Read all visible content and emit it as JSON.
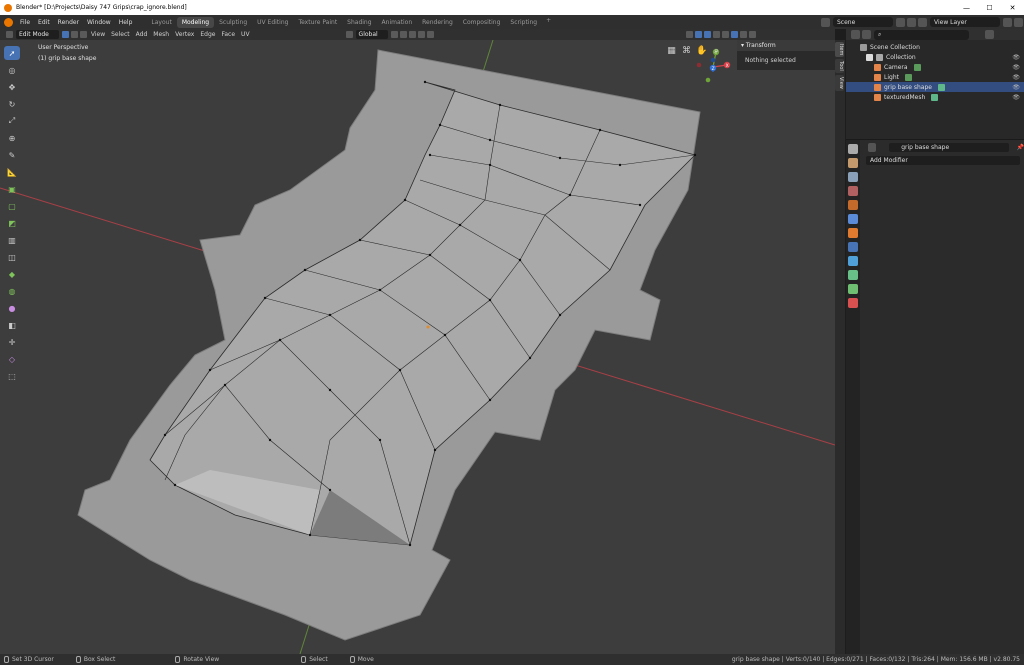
{
  "window": {
    "title": "Blender* [D:\\Projects\\Daisy 747 Grips\\crap_ignore.blend]",
    "min": "—",
    "max": "☐",
    "close": "✕"
  },
  "menu": {
    "items": [
      "File",
      "Edit",
      "Render",
      "Window",
      "Help"
    ],
    "workspaces": [
      "Layout",
      "Modeling",
      "Sculpting",
      "UV Editing",
      "Texture Paint",
      "Shading",
      "Animation",
      "Rendering",
      "Compositing",
      "Scripting"
    ],
    "active_workspace": "Modeling",
    "add": "+",
    "scene": "Scene",
    "view_layer": "View Layer"
  },
  "viewport_header": {
    "mode": "Edit Mode",
    "menus": [
      "View",
      "Select",
      "Add",
      "Mesh",
      "Vertex",
      "Edge",
      "Face",
      "UV"
    ],
    "orientation": "Global"
  },
  "viewport": {
    "view_name": "User Perspective",
    "object_label": "(1) grip base shape",
    "gizmo_axes": {
      "x": "X",
      "y": "Y",
      "z": "Z"
    }
  },
  "npanel": {
    "section": "Transform",
    "message": "Nothing selected",
    "tabs": [
      "Item",
      "Tool",
      "View"
    ]
  },
  "outliner": {
    "root": "Scene Collection",
    "rows": [
      {
        "label": "Collection",
        "color": "#aaaaaa"
      },
      {
        "label": "Camera",
        "color": "#e3854b"
      },
      {
        "label": "Light",
        "color": "#e3854b"
      },
      {
        "label": "grip base shape",
        "color": "#e3854b"
      },
      {
        "label": "texturedMesh",
        "color": "#e3854b"
      }
    ],
    "selected": "grip base shape"
  },
  "properties": {
    "object_name": "grip base shape",
    "add_modifier": "Add Modifier",
    "tab_colors": [
      "#aaaaaa",
      "#c49a6c",
      "#8aa0b8",
      "#b06060",
      "#c46a2a",
      "#5b8ad6",
      "#4fa0d8",
      "#68c088",
      "#d85050",
      "#6fbf73"
    ]
  },
  "statusbar": {
    "hints": [
      "Set 3D Cursor",
      "Box Select",
      "Rotate View",
      "Select",
      "Move"
    ],
    "stats": "grip base shape | Verts:0/140 | Edges:0/271 | Faces:0/132 | Tris:264 | Mem: 156.6 MB | v2.80.75"
  },
  "colors": {
    "accent": "#4772b3",
    "x_axis": "#d8414a",
    "y_axis": "#6fa538",
    "z_axis": "#2f6fd6",
    "mesh_base": "#8a8a8a"
  }
}
